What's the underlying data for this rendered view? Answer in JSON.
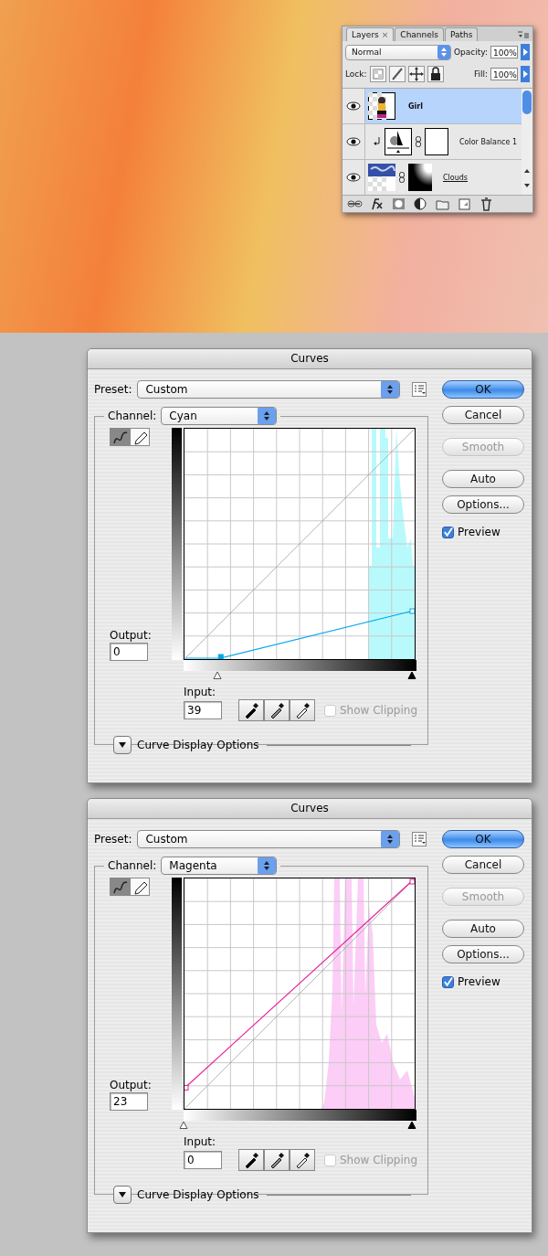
{
  "layers_panel": {
    "tabs": [
      {
        "label": "Layers",
        "close": "×",
        "selected": true
      },
      {
        "label": "Channels",
        "selected": false
      },
      {
        "label": "Paths",
        "selected": false
      }
    ],
    "blend_mode": "Normal",
    "opacity_label": "Opacity:",
    "opacity": "100%",
    "lock_label": "Lock:",
    "fill_label": "Fill:",
    "fill": "100%",
    "layers": [
      {
        "kind": "pixel",
        "name": "Girl",
        "visible": true,
        "selected": true,
        "clipped": false,
        "underlined": false
      },
      {
        "kind": "adjustment",
        "name": "Color Balance 1",
        "visible": true,
        "selected": false,
        "clipped": true,
        "underlined": false
      },
      {
        "kind": "masked",
        "name": "Clouds",
        "visible": true,
        "selected": false,
        "clipped": false,
        "underlined": true
      }
    ]
  },
  "dialogs": [
    {
      "title": "Curves",
      "preset_label": "Preset:",
      "preset": "Custom",
      "channel_label": "Channel:",
      "channel": "Cyan",
      "color": "#00a8e8",
      "tools": [
        {
          "kind": "curve",
          "selected": true
        },
        {
          "kind": "pencil",
          "selected": false
        }
      ],
      "output_label": "Output:",
      "output": "0",
      "input_label": "Input:",
      "input": "39",
      "input_slider": {
        "level": 0.153
      },
      "end_slider": {
        "level": 1
      },
      "show_clipping": {
        "label": "Show Clipping",
        "checked": false,
        "disabled": true
      },
      "display_options": {
        "label": "Curve Display Options",
        "expanded": false
      },
      "buttons": [
        {
          "label": "OK",
          "default": true,
          "disabled": false
        },
        {
          "label": "Cancel",
          "default": false,
          "disabled": false
        },
        {
          "label": "Smooth",
          "default": false,
          "disabled": true
        },
        {
          "label": "Auto",
          "default": false,
          "disabled": false
        },
        {
          "label": "Options...",
          "default": false,
          "disabled": false
        }
      ],
      "preview": {
        "label": "Preview",
        "checked": true
      }
    },
    {
      "title": "Curves",
      "preset_label": "Preset:",
      "preset": "Custom",
      "channel_label": "Channel:",
      "channel": "Magenta",
      "color": "#e8209a",
      "tools": [
        {
          "kind": "curve",
          "selected": true
        },
        {
          "kind": "pencil",
          "selected": false
        }
      ],
      "output_label": "Output:",
      "output": "23",
      "input_label": "Input:",
      "input": "0",
      "input_slider": {
        "level": 0
      },
      "end_slider": {
        "level": 1
      },
      "show_clipping": {
        "label": "Show Clipping",
        "checked": false,
        "disabled": true
      },
      "display_options": {
        "label": "Curve Display Options",
        "expanded": false
      },
      "buttons": [
        {
          "label": "OK",
          "default": true,
          "disabled": false
        },
        {
          "label": "Cancel",
          "default": false,
          "disabled": false
        },
        {
          "label": "Smooth",
          "default": false,
          "disabled": true
        },
        {
          "label": "Auto",
          "default": false,
          "disabled": false
        },
        {
          "label": "Options...",
          "default": false,
          "disabled": false
        }
      ],
      "preview": {
        "label": "Preview",
        "checked": true
      }
    }
  ]
}
